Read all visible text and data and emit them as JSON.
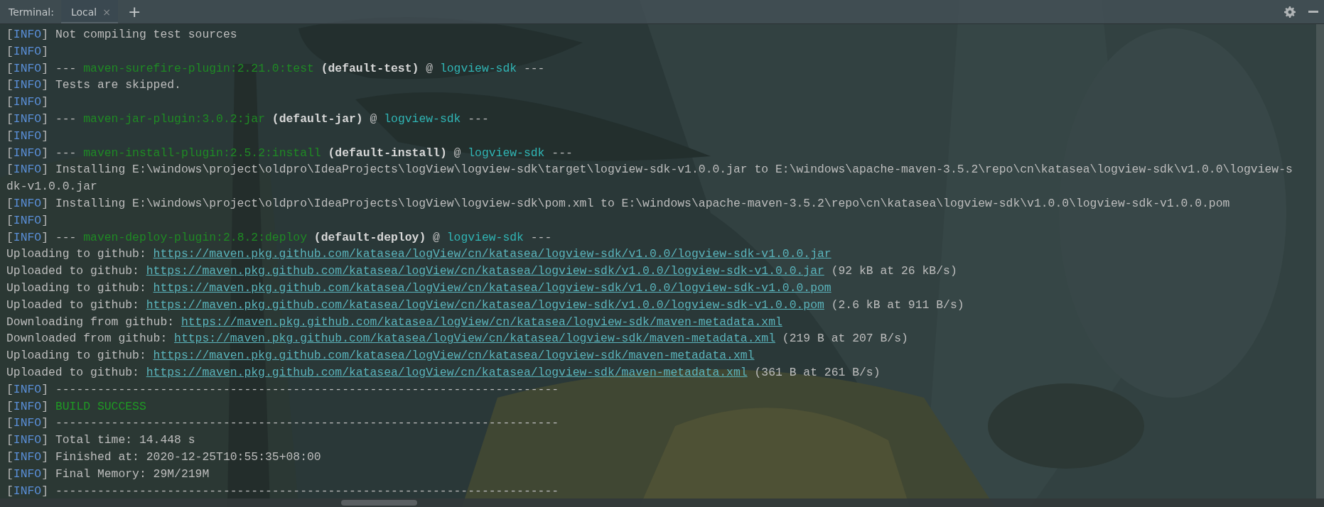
{
  "tab_bar": {
    "label": "Terminal:",
    "tabs": [
      {
        "label": "Local",
        "close": "×",
        "selected": true
      }
    ],
    "add": "+"
  },
  "lines": [
    [
      {
        "kind": "tag",
        "text": "[INFO]"
      },
      {
        "kind": "text",
        "text": " Not compiling test sources"
      }
    ],
    [
      {
        "kind": "tag",
        "text": "[INFO]"
      }
    ],
    [
      {
        "kind": "tag",
        "text": "[INFO]"
      },
      {
        "kind": "text",
        "text": " --- "
      },
      {
        "kind": "plugin",
        "text": "maven-surefire-plugin:2.21.0:test"
      },
      {
        "kind": "goal",
        "text": " (default-test)"
      },
      {
        "kind": "text",
        "text": " @ "
      },
      {
        "kind": "project",
        "text": "logview-sdk"
      },
      {
        "kind": "text",
        "text": " ---"
      }
    ],
    [
      {
        "kind": "tag",
        "text": "[INFO]"
      },
      {
        "kind": "text",
        "text": " Tests are skipped."
      }
    ],
    [
      {
        "kind": "tag",
        "text": "[INFO]"
      }
    ],
    [
      {
        "kind": "tag",
        "text": "[INFO]"
      },
      {
        "kind": "text",
        "text": " --- "
      },
      {
        "kind": "plugin",
        "text": "maven-jar-plugin:3.0.2:jar"
      },
      {
        "kind": "goal",
        "text": " (default-jar)"
      },
      {
        "kind": "text",
        "text": " @ "
      },
      {
        "kind": "project",
        "text": "logview-sdk"
      },
      {
        "kind": "text",
        "text": " ---"
      }
    ],
    [
      {
        "kind": "tag",
        "text": "[INFO]"
      }
    ],
    [
      {
        "kind": "tag",
        "text": "[INFO]"
      },
      {
        "kind": "text",
        "text": " --- "
      },
      {
        "kind": "plugin",
        "text": "maven-install-plugin:2.5.2:install"
      },
      {
        "kind": "goal",
        "text": " (default-install)"
      },
      {
        "kind": "text",
        "text": " @ "
      },
      {
        "kind": "project",
        "text": "logview-sdk"
      },
      {
        "kind": "text",
        "text": " ---"
      }
    ],
    [
      {
        "kind": "tag",
        "text": "[INFO]"
      },
      {
        "kind": "text",
        "text": " Installing E:\\windows\\project\\oldpro\\IdeaProjects\\logView\\logview-sdk\\target\\logview-sdk-v1.0.0.jar to E:\\windows\\apache-maven-3.5.2\\repo\\cn\\katasea\\logview-sdk\\v1.0.0\\logview-s"
      }
    ],
    [
      {
        "kind": "text",
        "text": "dk-v1.0.0.jar"
      }
    ],
    [
      {
        "kind": "tag",
        "text": "[INFO]"
      },
      {
        "kind": "text",
        "text": " Installing E:\\windows\\project\\oldpro\\IdeaProjects\\logView\\logview-sdk\\pom.xml to E:\\windows\\apache-maven-3.5.2\\repo\\cn\\katasea\\logview-sdk\\v1.0.0\\logview-sdk-v1.0.0.pom"
      }
    ],
    [
      {
        "kind": "tag",
        "text": "[INFO]"
      }
    ],
    [
      {
        "kind": "tag",
        "text": "[INFO]"
      },
      {
        "kind": "text",
        "text": " --- "
      },
      {
        "kind": "plugin",
        "text": "maven-deploy-plugin:2.8.2:deploy"
      },
      {
        "kind": "goal",
        "text": " (default-deploy)"
      },
      {
        "kind": "text",
        "text": " @ "
      },
      {
        "kind": "project",
        "text": "logview-sdk"
      },
      {
        "kind": "text",
        "text": " ---"
      }
    ],
    [
      {
        "kind": "text",
        "text": "Uploading to github: "
      },
      {
        "kind": "link",
        "text": "https://maven.pkg.github.com/katasea/logView/cn/katasea/logview-sdk/v1.0.0/logview-sdk-v1.0.0.jar"
      }
    ],
    [
      {
        "kind": "text",
        "text": "Uploaded to github: "
      },
      {
        "kind": "link",
        "text": "https://maven.pkg.github.com/katasea/logView/cn/katasea/logview-sdk/v1.0.0/logview-sdk-v1.0.0.jar"
      },
      {
        "kind": "text",
        "text": " (92 kB at 26 kB/s)"
      }
    ],
    [
      {
        "kind": "text",
        "text": "Uploading to github: "
      },
      {
        "kind": "link",
        "text": "https://maven.pkg.github.com/katasea/logView/cn/katasea/logview-sdk/v1.0.0/logview-sdk-v1.0.0.pom"
      }
    ],
    [
      {
        "kind": "text",
        "text": "Uploaded to github: "
      },
      {
        "kind": "link",
        "text": "https://maven.pkg.github.com/katasea/logView/cn/katasea/logview-sdk/v1.0.0/logview-sdk-v1.0.0.pom"
      },
      {
        "kind": "text",
        "text": " (2.6 kB at 911 B/s)"
      }
    ],
    [
      {
        "kind": "text",
        "text": "Downloading from github: "
      },
      {
        "kind": "link",
        "text": "https://maven.pkg.github.com/katasea/logView/cn/katasea/logview-sdk/maven-metadata.xml"
      }
    ],
    [
      {
        "kind": "text",
        "text": "Downloaded from github: "
      },
      {
        "kind": "link",
        "text": "https://maven.pkg.github.com/katasea/logView/cn/katasea/logview-sdk/maven-metadata.xml"
      },
      {
        "kind": "text",
        "text": " (219 B at 207 B/s)"
      }
    ],
    [
      {
        "kind": "text",
        "text": "Uploading to github: "
      },
      {
        "kind": "link",
        "text": "https://maven.pkg.github.com/katasea/logView/cn/katasea/logview-sdk/maven-metadata.xml"
      }
    ],
    [
      {
        "kind": "text",
        "text": "Uploaded to github: "
      },
      {
        "kind": "link",
        "text": "https://maven.pkg.github.com/katasea/logView/cn/katasea/logview-sdk/maven-metadata.xml"
      },
      {
        "kind": "text",
        "text": " (361 B at 261 B/s)"
      }
    ],
    [
      {
        "kind": "tag",
        "text": "[INFO]"
      },
      {
        "kind": "text",
        "text": " ------------------------------------------------------------------------"
      }
    ],
    [
      {
        "kind": "tag",
        "text": "[INFO]"
      },
      {
        "kind": "success",
        "text": "BUILD SUCCESS"
      }
    ],
    [
      {
        "kind": "tag",
        "text": "[INFO]"
      },
      {
        "kind": "text",
        "text": " ------------------------------------------------------------------------"
      }
    ],
    [
      {
        "kind": "tag",
        "text": "[INFO]"
      },
      {
        "kind": "text",
        "text": " Total time: 14.448 s"
      }
    ],
    [
      {
        "kind": "tag",
        "text": "[INFO]"
      },
      {
        "kind": "text",
        "text": " Finished at: 2020-12-25T10:55:35+08:00"
      }
    ],
    [
      {
        "kind": "tag",
        "text": "[INFO]"
      },
      {
        "kind": "text",
        "text": " Final Memory: 29M/219M"
      }
    ],
    [
      {
        "kind": "tag",
        "text": "[INFO]"
      },
      {
        "kind": "text",
        "text": " ------------------------------------------------------------------------"
      }
    ]
  ]
}
